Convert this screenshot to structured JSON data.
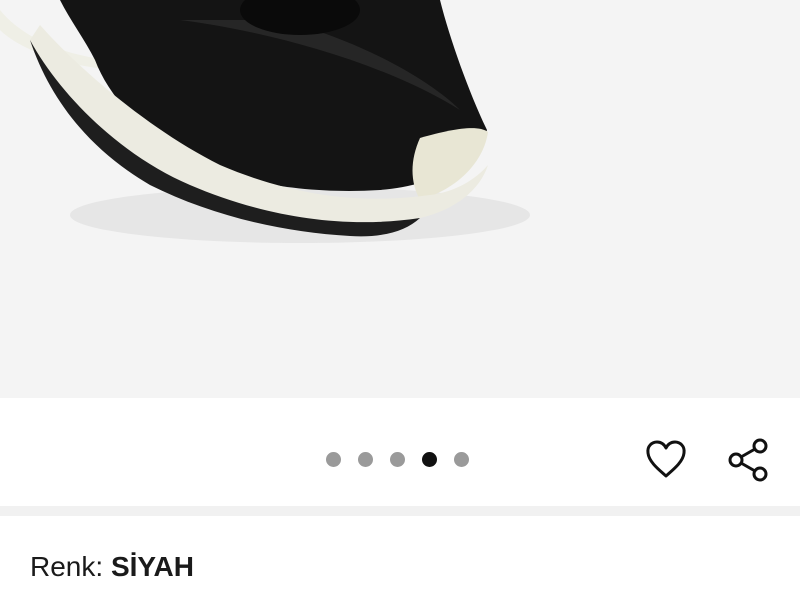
{
  "gallery": {
    "image_alt_icon": "sneaker-product-image",
    "total_images": 5,
    "active_index": 3
  },
  "actions": {
    "favorite_icon": "heart-icon",
    "share_icon": "share-icon"
  },
  "product": {
    "color_label": "Renk:",
    "color_value": "SİYAH"
  },
  "colors": {
    "image_background": "#f4f4f4",
    "dot_inactive": "#9a9a9a",
    "dot_active": "#111111",
    "divider": "#f1f1f1",
    "text": "#1a1a1a"
  }
}
